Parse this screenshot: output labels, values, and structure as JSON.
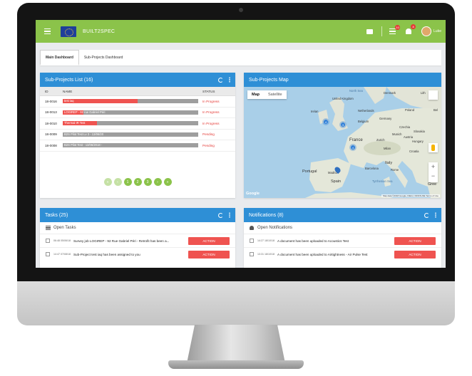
{
  "appbar": {
    "brand": "BUILT2SPEC",
    "list_badge": "10",
    "bell_badge": "8",
    "user_name": "Luke"
  },
  "tabs": [
    {
      "label": "Main Dashboard",
      "active": true
    },
    {
      "label": "Sub-Projects Dashboard",
      "active": false
    }
  ],
  "subprojects": {
    "title": "Sub-Projects List (16)",
    "columns": {
      "id": "ID",
      "name": "NAME",
      "status": "STATUS"
    },
    "rows": [
      {
        "id": "18-0016",
        "name": "test iaq",
        "progress": 0.55,
        "status": "In Progress"
      },
      {
        "id": "18-0013",
        "name": "LOGIREP - 92 rue Gabriel Péri",
        "progress": 0.15,
        "status": "In Progress"
      },
      {
        "id": "18-0010",
        "name": "Thermal IR Test",
        "progress": 0.25,
        "status": "In Progress"
      },
      {
        "id": "18-0009",
        "name": "B2S Pilot Test Lv 3 - 13/06/20",
        "progress": 0.0,
        "status": "Pending"
      },
      {
        "id": "18-0008",
        "name": "B2S Pilot Test - 13/06/2018 -",
        "progress": 0.0,
        "status": "Pending"
      }
    ],
    "pager": [
      "«",
      "‹",
      "1",
      "2",
      "3",
      "›",
      "»"
    ]
  },
  "map": {
    "title": "Sub-Projects Map",
    "toggle_map": "Map",
    "toggle_satellite": "Satellite",
    "clusters": [
      "4",
      "3",
      "4"
    ],
    "labels": {
      "north_sea": "North Sea",
      "denmark": "Denmark",
      "lith": "Lith",
      "uk": "United Kingdom",
      "ireland": "Irelan",
      "netherlands": "Netherlands",
      "poland": "Poland",
      "bel": "Bel",
      "germany": "Germany",
      "belgium": "Belgium",
      "czechia": "Czechia",
      "slovakia": "Slovakia",
      "austria": "Austria",
      "hungary": "Hungary",
      "france": "France",
      "croatia": "Croatia",
      "italy": "Italy",
      "portugal": "Portugal",
      "madrid": "Madrid",
      "spain": "Spain",
      "barcelona": "Barcelona",
      "rome": "Rome",
      "tyrrhenian": "Tyrrhenian Sea",
      "greece": "Gree",
      "munich": "Munich",
      "zurich": "Zurich",
      "milan": "Milan"
    },
    "google": "Google",
    "terms": "Map data ©2018 Google, INEGI, ORION-ME   Terms of Use"
  },
  "tasks": {
    "title": "Tasks (25)",
    "section_label": "Open Tasks",
    "items": [
      {
        "time": "06:48 05/06/18",
        "text": "Survey job LOGIREP - 92 Rue Gabriel Péri - Retrofit has been a...",
        "action": "ACTION"
      },
      {
        "time": "14:47 07/08/18",
        "text": "Sub-Project test iaq has been assigned to you",
        "action": "ACTION"
      }
    ]
  },
  "notifications": {
    "title": "Notifications (8)",
    "section_label": "Open Notifications",
    "items": [
      {
        "time": "14:27 18/10/18",
        "text": "A document has been uploaded to Acoustics Test",
        "action": "ACTION"
      },
      {
        "time": "13:31 18/10/18",
        "text": "A document has been uploaded to Airtightness - Air Pulse Test",
        "action": "ACTION"
      }
    ]
  }
}
